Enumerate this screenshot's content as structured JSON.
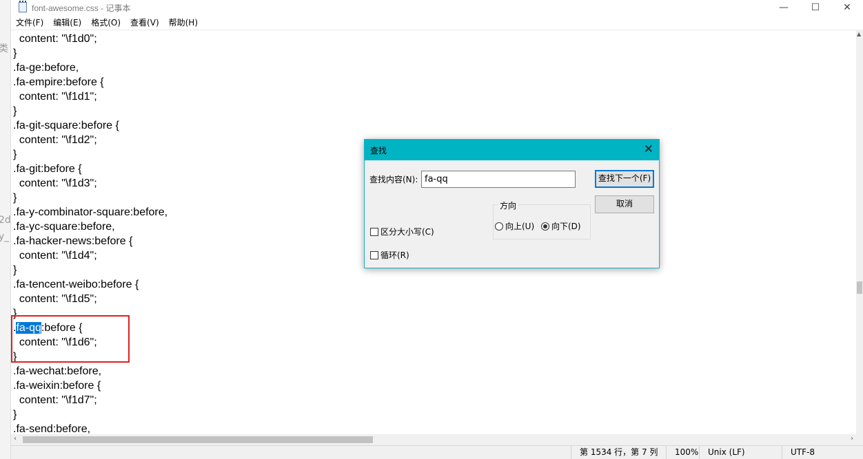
{
  "window": {
    "title": "font-awesome.css - 记事本",
    "minimize_glyph": "—",
    "maximize_glyph": "☐",
    "close_glyph": "✕"
  },
  "background_fragments": [
    "类",
    "2d",
    "y_"
  ],
  "menu": [
    "文件(F)",
    "编辑(E)",
    "格式(O)",
    "查看(V)",
    "帮助(H)"
  ],
  "editor": {
    "lines": [
      "  content: \"\\f1d0\";",
      "}",
      ".fa-ge:before,",
      ".fa-empire:before {",
      "  content: \"\\f1d1\";",
      "}",
      ".fa-git-square:before {",
      "  content: \"\\f1d2\";",
      "}",
      ".fa-git:before {",
      "  content: \"\\f1d3\";",
      "}",
      ".fa-y-combinator-square:before,",
      ".fa-yc-square:before,",
      ".fa-hacker-news:before {",
      "  content: \"\\f1d4\";",
      "}",
      ".fa-tencent-weibo:before {",
      "  content: \"\\f1d5\";",
      "}",
      ".fa-qq:before {",
      "  content: \"\\f1d6\";",
      "}",
      ".fa-wechat:before,",
      ".fa-weixin:before {",
      "  content: \"\\f1d7\";",
      "}",
      ".fa-send:before,"
    ],
    "selected_line_index": 20,
    "selected_text": "fa-qq",
    "selection_color": "#0078d7",
    "highlight_box_color": "#e02020"
  },
  "find_dialog": {
    "title": "查找",
    "close_glyph": "✕",
    "find_label": "查找内容(N):",
    "find_value": "fa-qq",
    "find_next_label": "查找下一个(F)",
    "cancel_label": "取消",
    "direction_label": "方向",
    "up_label": "向上(U)",
    "down_label": "向下(D)",
    "direction_selected": "down",
    "match_case_label": "区分大小写(C)",
    "match_case_checked": false,
    "wrap_label": "循环(R)",
    "wrap_checked": false,
    "title_color": "#00b4c4"
  },
  "statusbar": {
    "position": "第 1534 行，第 7 列",
    "zoom": "100%",
    "line_ending": "Unix (LF)",
    "encoding": "UTF-8"
  }
}
